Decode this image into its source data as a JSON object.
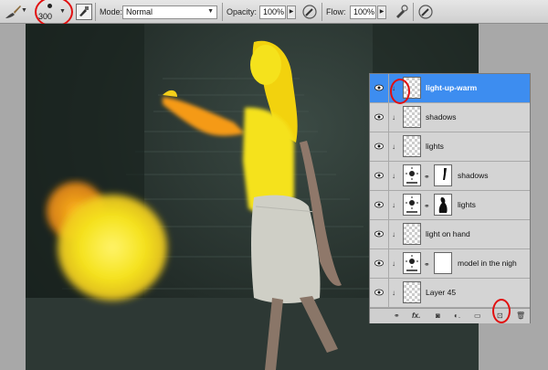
{
  "options_bar": {
    "tool_icon": "brush-icon",
    "brush_size": "300",
    "mode_label": "Mode:",
    "mode_value": "Normal",
    "opacity_label": "Opacity:",
    "opacity_value": "100%",
    "flow_label": "Flow:",
    "flow_value": "100%",
    "airbrush_icon": "airbrush-icon",
    "brush_panel_icon": "brush-panel-icon"
  },
  "layers": [
    {
      "name": "light-up-warm",
      "kind": "pixel",
      "selected": true,
      "clipped": true
    },
    {
      "name": "shadows",
      "kind": "pixel",
      "selected": false,
      "clipped": true
    },
    {
      "name": "lights",
      "kind": "pixel",
      "selected": false,
      "clipped": true
    },
    {
      "name": "shadows",
      "kind": "adjustment",
      "selected": false,
      "clipped": true
    },
    {
      "name": "lights",
      "kind": "adjustment",
      "selected": false,
      "clipped": true
    },
    {
      "name": "light on hand",
      "kind": "pixel",
      "selected": false,
      "clipped": true
    },
    {
      "name": "model in the nigh",
      "kind": "adjustment",
      "selected": false,
      "clipped": true
    },
    {
      "name": "Layer 45",
      "kind": "pixel",
      "selected": false,
      "clipped": true
    }
  ],
  "layers_footer_icons": [
    "link-icon",
    "fx-icon",
    "mask-icon",
    "adjustment-icon",
    "group-icon",
    "new-layer-icon",
    "trash-icon"
  ],
  "colors": {
    "selection": "#3d8df0",
    "annotation_red": "#e10f0f",
    "paint_yellow": "#f5e21c",
    "paint_orange": "#f59a16"
  }
}
